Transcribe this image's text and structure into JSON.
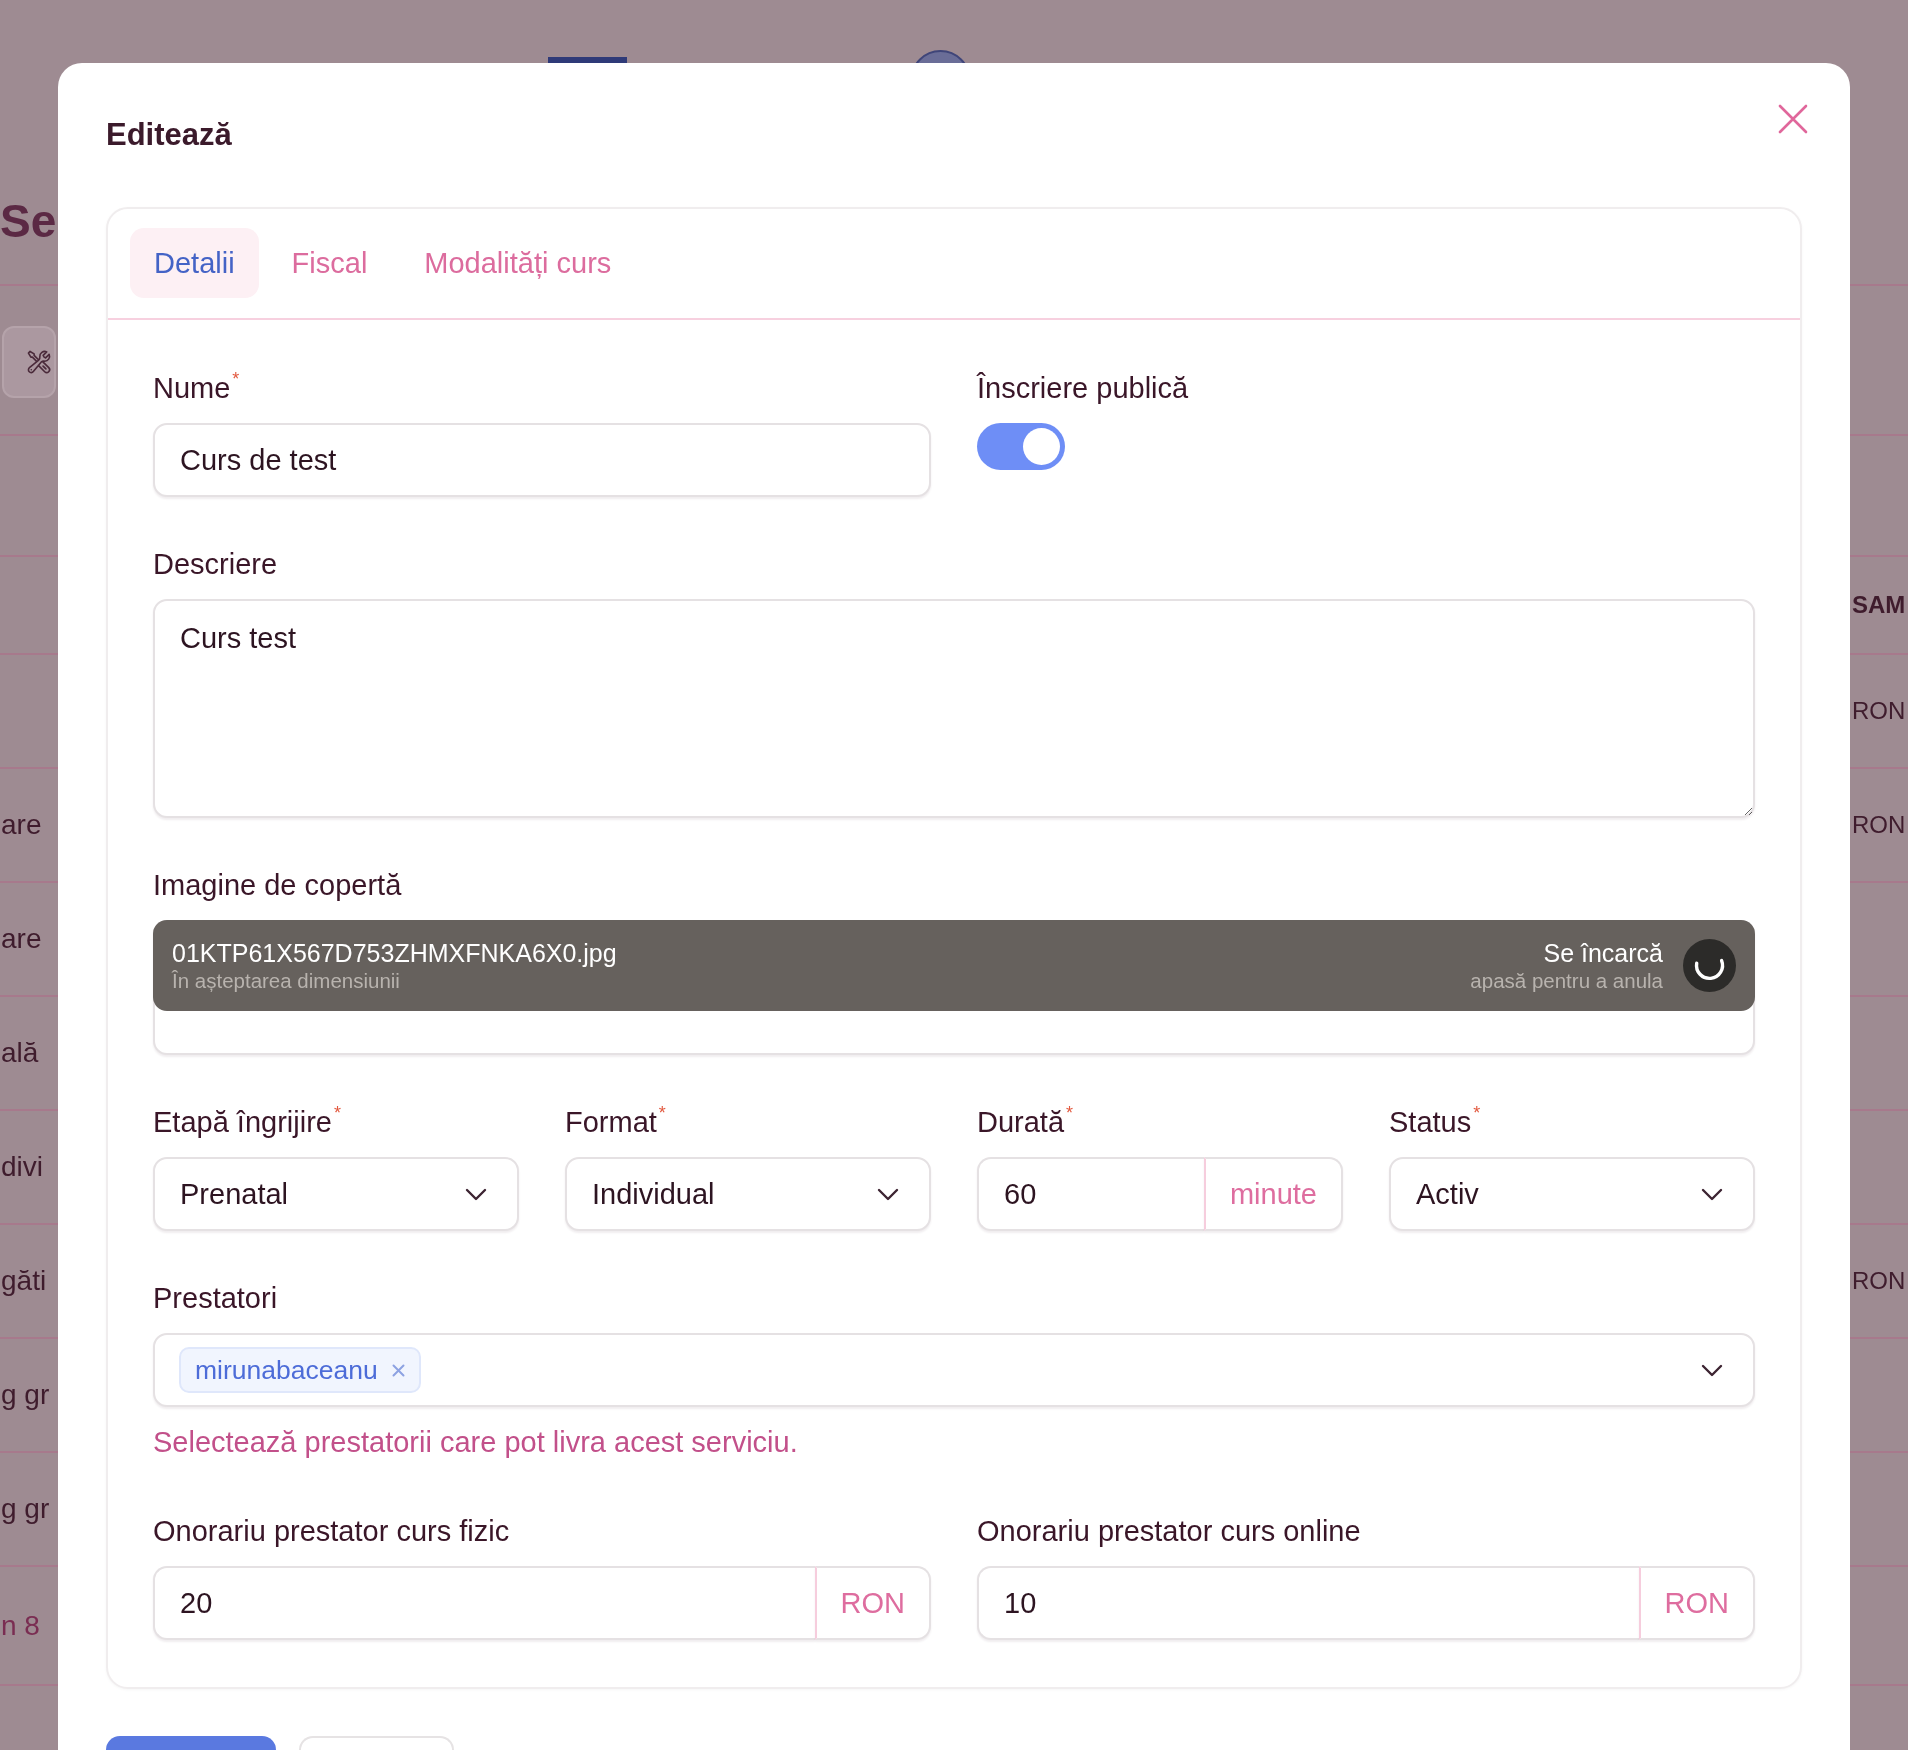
{
  "page": {
    "heading": "Se",
    "table": {
      "rows": [
        {
          "kind": "header",
          "column_2": "SAM"
        },
        {
          "kind": "row",
          "column_2": "RON"
        },
        {
          "kind": "row",
          "column_1": "are",
          "column_2": "RON"
        },
        {
          "kind": "row",
          "column_1": "are"
        },
        {
          "kind": "row",
          "column_1": "ală"
        },
        {
          "kind": "row",
          "column_1": "divi"
        },
        {
          "kind": "row",
          "column_1": "găti",
          "column_2": "RON"
        },
        {
          "kind": "row",
          "column_1": "g gr"
        },
        {
          "kind": "row",
          "column_1": "g gr"
        },
        {
          "kind": "footer",
          "column_1": "n 8"
        }
      ]
    }
  },
  "dialog": {
    "title": "Editează",
    "tabs": [
      {
        "label": "Detalii",
        "selected": true
      },
      {
        "label": "Fiscal",
        "selected": false
      },
      {
        "label": "Modalități curs",
        "selected": false
      }
    ],
    "form": {
      "name": {
        "label": "Nume$^{*}$",
        "value": "Curs de test"
      },
      "public_enrollment": {
        "label": "Înscriere publică",
        "on": true
      },
      "description": {
        "label": "Descriere",
        "value": "Curs test"
      },
      "cover_image": {
        "label": "Imagine de copertă",
        "file": {
          "name": "01KTP61X567D753ZHMXFNKA6X0.jpg",
          "detail": "În așteptarea dimensiunii",
          "status": "Se încarcă",
          "hint": "apasă pentru a anula"
        }
      },
      "details": [
        {
          "kind": "select",
          "label": "Etapă îngrijire$^{*}$",
          "value": "Prenatal"
        },
        {
          "kind": "select",
          "label": "Format$^{*}$",
          "value": "Individual"
        },
        {
          "kind": "unit",
          "label": "Durată$^{*}$",
          "value": "60",
          "unit": "minute"
        },
        {
          "kind": "select",
          "label": "Status$^{*}$",
          "value": "Activ"
        }
      ],
      "providers": {
        "label": "Prestatori",
        "tags": [
          "mirunabaceanu"
        ],
        "help": "Selectează prestatorii care pot livra acest serviciu."
      },
      "fees": [
        {
          "label": "Onorariu prestator curs fizic",
          "value": "20",
          "unit": "RON"
        },
        {
          "label": "Onorariu prestator curs online",
          "value": "10",
          "unit": "RON"
        }
      ]
    },
    "footer_buttons": [
      {
        "kind": "primary"
      },
      {
        "kind": "secondary"
      }
    ]
  }
}
